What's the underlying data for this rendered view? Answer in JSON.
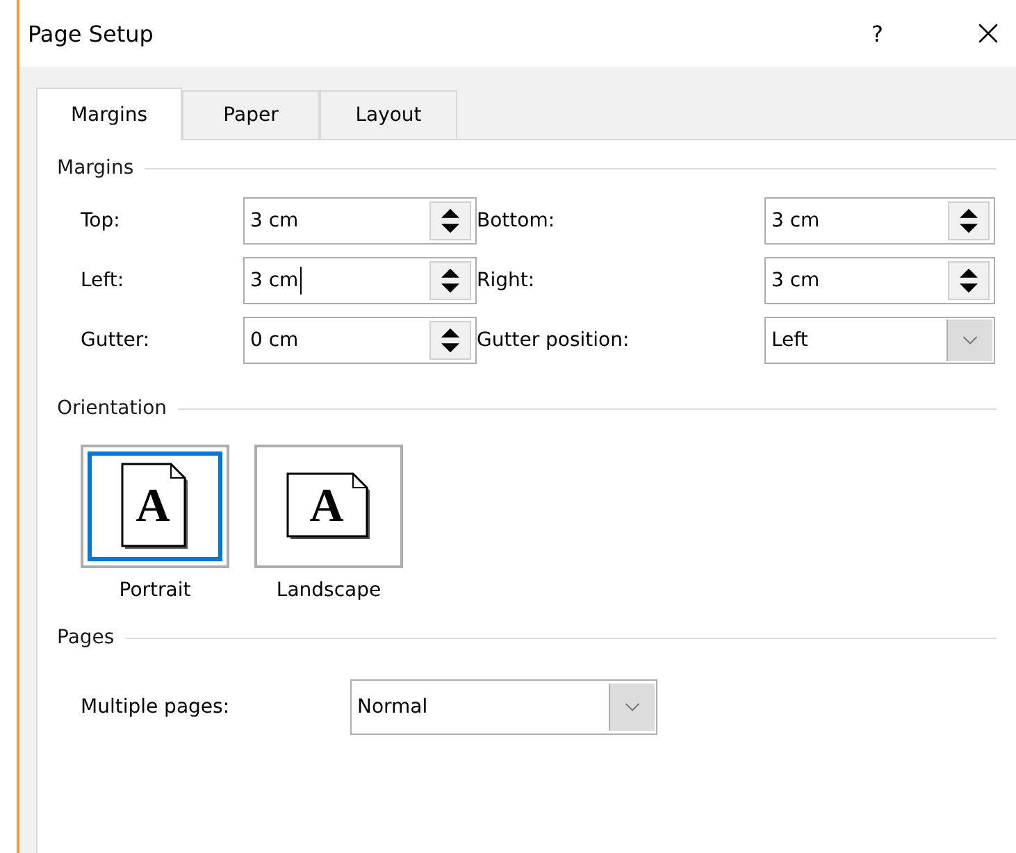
{
  "window": {
    "title": "Page Setup",
    "help": "?"
  },
  "tabs": [
    {
      "label": "Margins",
      "selected": true
    },
    {
      "label": "Paper",
      "selected": false
    },
    {
      "label": "Layout",
      "selected": false
    }
  ],
  "margins": {
    "heading": "Margins",
    "fields": [
      {
        "label": "Top:",
        "value": "3 cm",
        "kind": "spin",
        "focused": false
      },
      {
        "label": "Bottom:",
        "value": "3 cm",
        "kind": "spin",
        "focused": false
      },
      {
        "label": "Left:",
        "value": "3 cm",
        "kind": "spin",
        "focused": true
      },
      {
        "label": "Right:",
        "value": "3 cm",
        "kind": "spin",
        "focused": false
      },
      {
        "label": "Gutter:",
        "value": "0 cm",
        "kind": "spin",
        "focused": false
      },
      {
        "label": "Gutter position:",
        "value": "Left",
        "kind": "dropdown",
        "focused": false
      }
    ]
  },
  "orientation": {
    "heading": "Orientation",
    "options": [
      {
        "label": "Portrait",
        "glyph": "A",
        "kind": "portrait",
        "selected": true
      },
      {
        "label": "Landscape",
        "glyph": "A",
        "kind": "landscape",
        "selected": false
      }
    ]
  },
  "pages": {
    "heading": "Pages",
    "label": "Multiple pages:",
    "value": "Normal"
  }
}
